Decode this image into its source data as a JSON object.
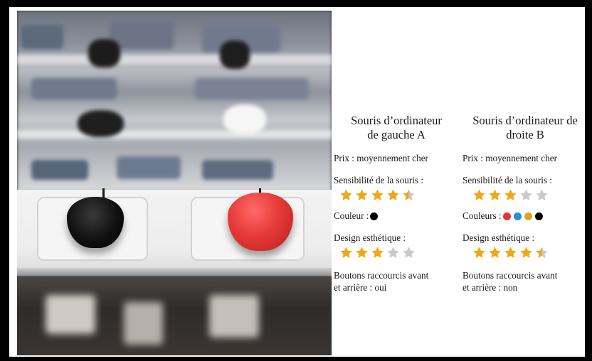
{
  "left": {
    "title_line1": "Souris d’ordinateur",
    "title_line2": "de gauche A",
    "price": "Prix : moyennement cher",
    "sensitivity_label": "Sensibilité de la souris :",
    "sensitivity_rating": 4.5,
    "color_label": "Couleur :",
    "colors": [
      "#000000"
    ],
    "design_label": "Design esthétique :",
    "design_rating": 3,
    "buttons_line1": "Boutons raccourcis avant",
    "buttons_line2": "et arrière : oui"
  },
  "right": {
    "title_line1": "Souris d’ordinateur de",
    "title_line2": "droite B",
    "price": "Prix : moyennement cher",
    "sensitivity_label": "Sensibilité de la souris :",
    "sensitivity_rating": 3,
    "color_label": "Couleurs :",
    "colors": [
      "#e8323c",
      "#1e90d6",
      "#e0a020",
      "#000000"
    ],
    "design_label": "Design esthétique :",
    "design_rating": 4.5,
    "buttons_line1": "Boutons raccourcis avant",
    "buttons_line2": "et arrière : non"
  },
  "style": {
    "star_filled": "#f0a817",
    "star_empty": "#c9c9c9",
    "left_mouse": "#111111",
    "right_mouse": "#e83a3a"
  }
}
